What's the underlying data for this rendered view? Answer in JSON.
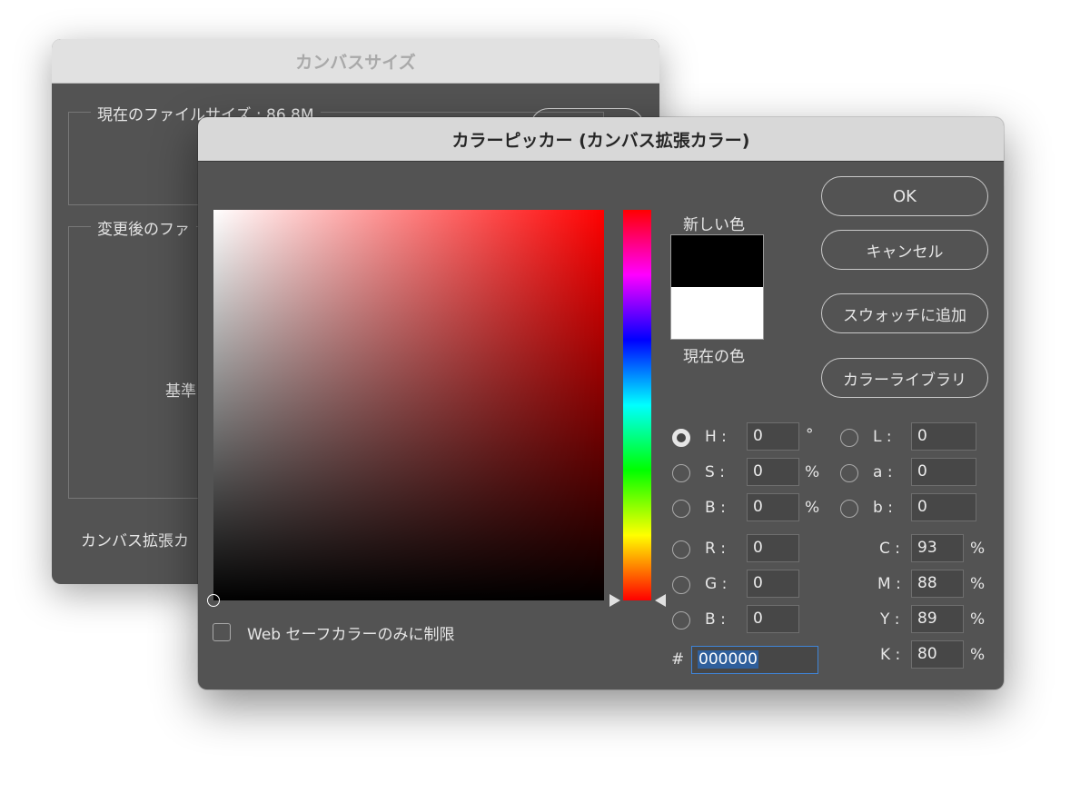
{
  "background_dialog": {
    "title": "カンバスサイズ",
    "current_size_label": "現在のファイルサイズ : 86.8M",
    "new_size_label": "変更後のファ",
    "anchor_label": "基準",
    "extension_color_label": "カンバス拡張カ"
  },
  "color_picker": {
    "title": "カラーピッカー (カンバス拡張カラー)",
    "new_color_label": "新しい色",
    "current_color_label": "現在の色",
    "new_color": "#000000",
    "current_color": "#ffffff",
    "buttons": {
      "ok": "OK",
      "cancel": "キャンセル",
      "add_swatch": "スウォッチに追加",
      "color_library": "カラーライブラリ"
    },
    "web_safe_label": "Web セーフカラーのみに制限",
    "hsb": {
      "h": {
        "label": "H :",
        "value": "0",
        "unit": "°",
        "selected": true
      },
      "s": {
        "label": "S :",
        "value": "0",
        "unit": "%"
      },
      "b": {
        "label": "B :",
        "value": "0",
        "unit": "%"
      }
    },
    "lab": {
      "l": {
        "label": "L :",
        "value": "0"
      },
      "a": {
        "label": "a :",
        "value": "0"
      },
      "b": {
        "label": "b :",
        "value": "0"
      }
    },
    "rgb": {
      "r": {
        "label": "R :",
        "value": "0"
      },
      "g": {
        "label": "G :",
        "value": "0"
      },
      "b": {
        "label": "B :",
        "value": "0"
      }
    },
    "cmyk": {
      "c": {
        "label": "C :",
        "value": "93",
        "unit": "%"
      },
      "m": {
        "label": "M :",
        "value": "88",
        "unit": "%"
      },
      "y": {
        "label": "Y :",
        "value": "89",
        "unit": "%"
      },
      "k": {
        "label": "K :",
        "value": "80",
        "unit": "%"
      }
    },
    "hex": {
      "label": "#",
      "value": "000000"
    }
  }
}
